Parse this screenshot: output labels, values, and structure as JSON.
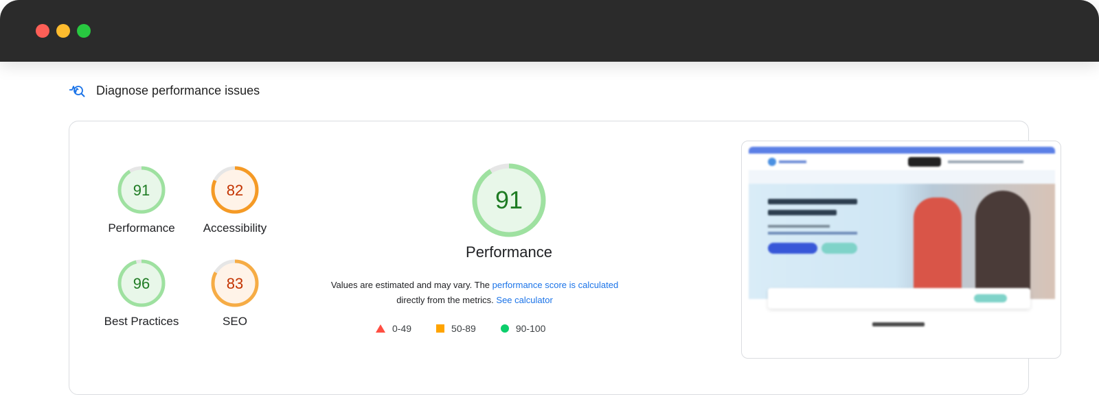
{
  "window": {
    "controls": [
      "close",
      "minimize",
      "maximize"
    ]
  },
  "section": {
    "title": "Diagnose performance issues",
    "icon": "performance-search-icon"
  },
  "scores": [
    {
      "label": "Performance",
      "value": "91",
      "fraction": 0.91,
      "color": "#0cce6b",
      "ring": "#9ee1a0",
      "text": "#1e7b23",
      "fill": "#e8f7e9"
    },
    {
      "label": "Accessibility",
      "value": "82",
      "fraction": 0.82,
      "color": "#ffa400",
      "ring": "#f59a25",
      "text": "#c33300",
      "fill": "#fff3e8"
    },
    {
      "label": "Best Practices",
      "value": "96",
      "fraction": 0.96,
      "color": "#0cce6b",
      "ring": "#9ee1a0",
      "text": "#1e7b23",
      "fill": "#e8f7e9"
    },
    {
      "label": "SEO",
      "value": "83",
      "fraction": 0.83,
      "color": "#ffa400",
      "ring": "#f6ac45",
      "text": "#c33300",
      "fill": "#fff3e8"
    }
  ],
  "main_score": {
    "label": "Performance",
    "value": "91",
    "fraction": 0.91
  },
  "description": {
    "prefix": "Values are estimated and may vary. The ",
    "link1": "performance score is calculated",
    "middle": "directly from the metrics. ",
    "link2": "See calculator"
  },
  "legend": [
    {
      "range": "0-49",
      "shape": "triangle",
      "color": "#ff4e42"
    },
    {
      "range": "50-89",
      "shape": "square",
      "color": "#ffa400"
    },
    {
      "range": "90-100",
      "shape": "circle",
      "color": "#0cce6b"
    }
  ]
}
